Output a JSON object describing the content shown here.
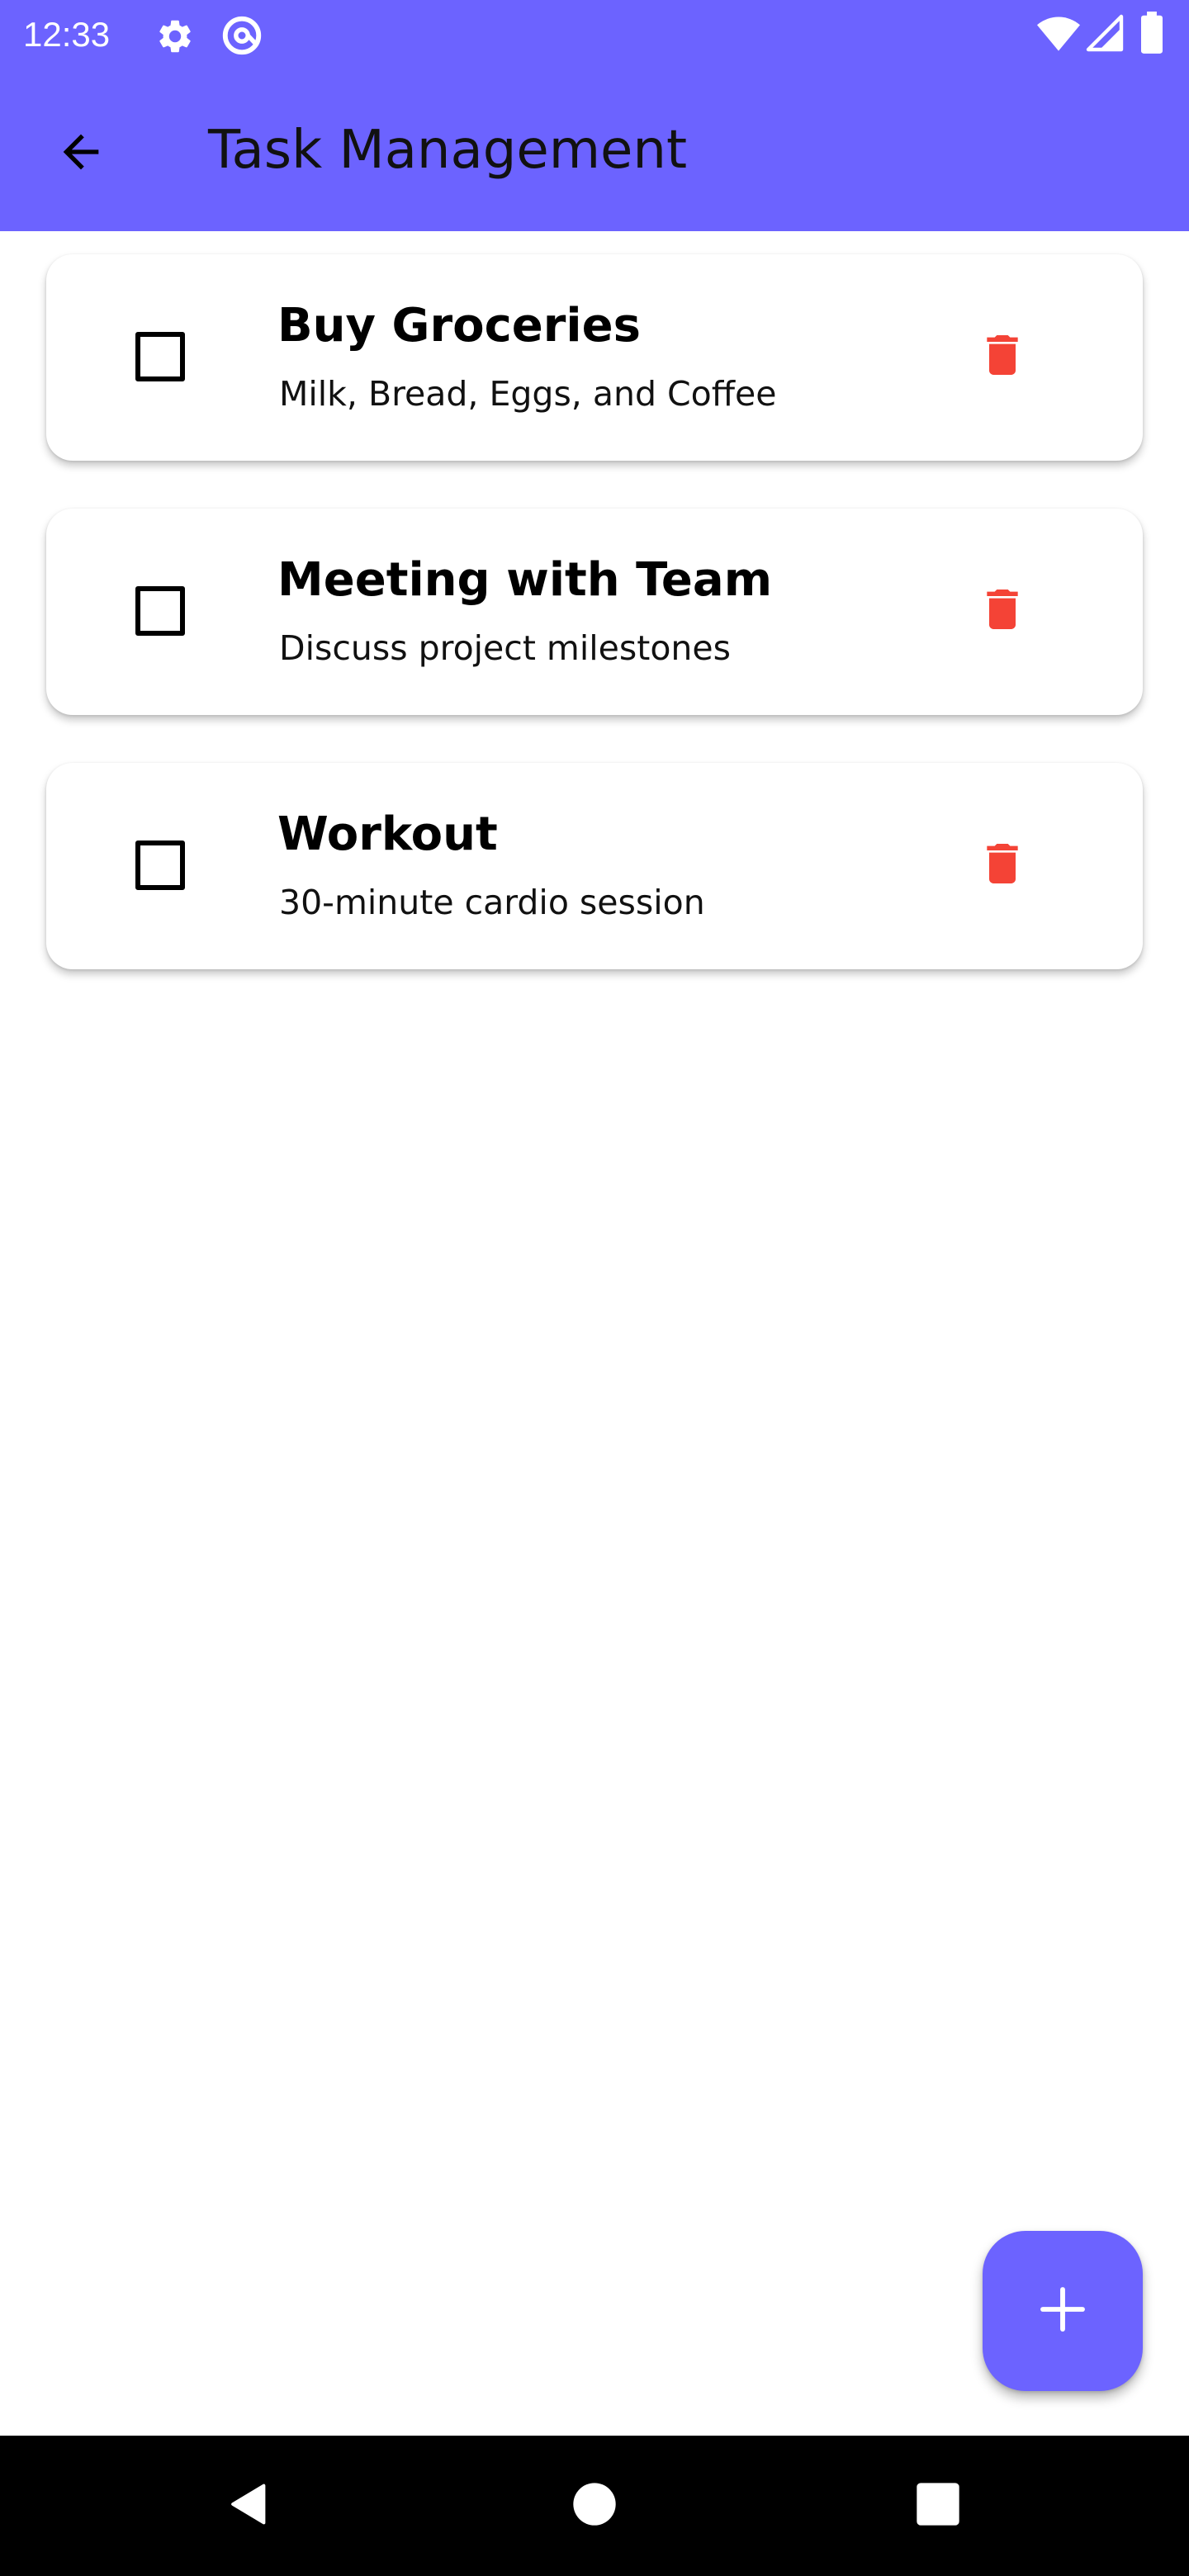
{
  "status_bar": {
    "time": "12:33",
    "icons": [
      "gear-icon",
      "at-sign-icon",
      "wifi-icon",
      "cell-signal-icon",
      "battery-icon"
    ]
  },
  "app_bar": {
    "title": "Task Management",
    "back_icon": "arrow-left-icon"
  },
  "tasks": [
    {
      "title": "Buy Groceries",
      "description": "Milk, Bread, Eggs, and Coffee",
      "checked": false
    },
    {
      "title": "Meeting with Team",
      "description": "Discuss project milestones",
      "checked": false
    },
    {
      "title": "Workout",
      "description": "30-minute cardio session",
      "checked": false
    }
  ],
  "fab": {
    "icon": "plus-icon"
  },
  "nav_bar": {
    "icons": [
      "back-triangle-icon",
      "home-circle-icon",
      "recents-square-icon"
    ]
  },
  "colors": {
    "primary": "#6c63ff",
    "delete": "#f44336",
    "nav_bar": "#000000"
  }
}
